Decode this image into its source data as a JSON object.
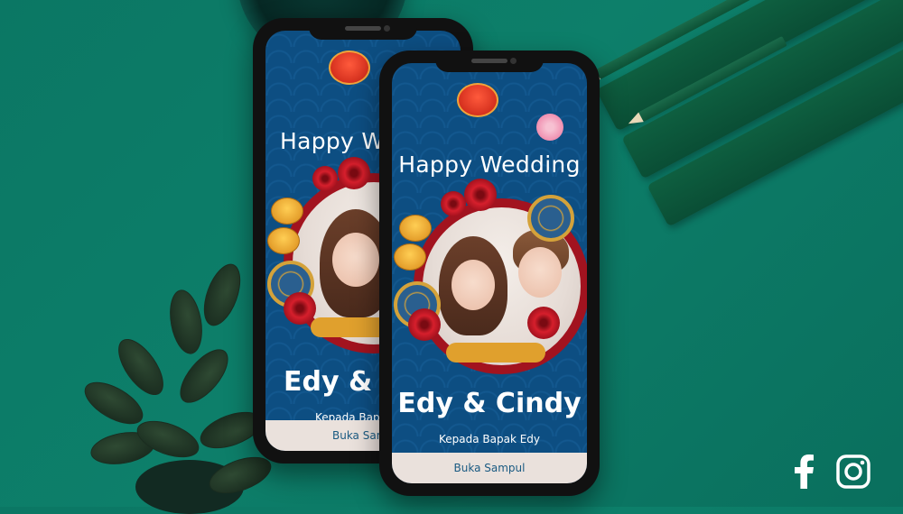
{
  "back_phone": {
    "title": "Happy We",
    "names": "Edy & C",
    "guest_line": "Kepada Bapak",
    "open_button": "Buka Samp"
  },
  "front_phone": {
    "title": "Happy Wedding",
    "names": "Edy & Cindy",
    "guest_line": "Kepada Bapak Edy",
    "open_button": "Buka Sampul"
  },
  "social_icons": [
    {
      "name": "facebook-icon",
      "glyph": "f"
    },
    {
      "name": "instagram-icon",
      "glyph": ""
    }
  ],
  "colors": {
    "background": "#0d7f6a",
    "invite_blue": "#0d4e82",
    "frame_red": "#a2131f",
    "gold": "#e0a02d",
    "button_bg": "#eae1dc"
  }
}
